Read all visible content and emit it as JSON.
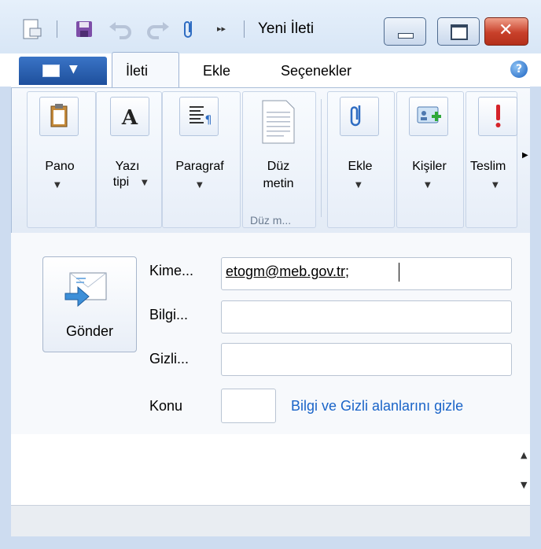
{
  "window": {
    "title": "Yeni İleti",
    "quick_access_more": "▸▸"
  },
  "ribbon": {
    "tabs": [
      {
        "label": "İleti",
        "active": true
      },
      {
        "label": "Ekle",
        "active": false
      },
      {
        "label": "Seçenekler",
        "active": false
      }
    ],
    "help": "?",
    "groups": [
      {
        "label": "Pano",
        "has_dropdown": true,
        "icon": "clipboard-icon"
      },
      {
        "label_line1": "Yazı",
        "label_line2": "tipi",
        "has_dropdown": true,
        "icon": "font-icon"
      },
      {
        "label": "Paragraf",
        "has_dropdown": true,
        "icon": "paragraph-icon"
      },
      {
        "label_line1": "Düz",
        "label_line2": "metin",
        "caption": "Düz m...",
        "icon": "plain-text-icon"
      },
      {
        "label": "Ekle",
        "has_dropdown": true,
        "icon": "attach-icon"
      },
      {
        "label": "Kişiler",
        "has_dropdown": true,
        "icon": "contacts-icon"
      },
      {
        "label": "Teslim",
        "has_dropdown": true,
        "icon": "priority-icon"
      }
    ]
  },
  "compose": {
    "send_label": "Gönder",
    "to_label": "Kime...",
    "to_value": "etogm@meb.gov.tr;",
    "cc_label": "Bilgi...",
    "bcc_label": "Gizli...",
    "subject_label": "Konu",
    "hide_link": "Bilgi ve Gizli alanlarını gizle"
  },
  "colors": {
    "accent": "#1e4f9c",
    "link": "#1a64c8",
    "close": "#c8402a"
  }
}
